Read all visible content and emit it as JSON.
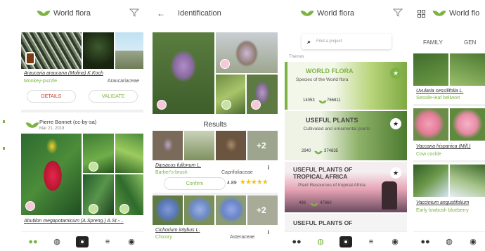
{
  "s1": {
    "title": "World flora",
    "obs1_species": "Araucaria araucana (Molina) K.Koch",
    "obs1_common": "Monkey-puzzle",
    "obs1_family": "Araucariaceae",
    "details_label": "DETAILS",
    "validate_label": "VALIDATE",
    "obs2_author": "Pierre Bonnet (cc-by-sa)",
    "obs2_date": "Mar 21, 2019",
    "obs3_species": "Abutilon megapotamicum (A.Spreng.) A.St.-..."
  },
  "s2": {
    "title": "Identification",
    "results_label": "Results",
    "r1_species": "Dipsacus fullonum L.",
    "r1_common": "Barber's-brush",
    "r1_family": "Caprifoliaceae",
    "r1_score": "4.89",
    "confirm_label": "Confirm",
    "plus_more": "+2",
    "r2_species": "Cichorium intybus L.",
    "r2_common": "Chicory",
    "r2_family": "Asteraceae",
    "r2_plus": "+2",
    "info": "i"
  },
  "s3": {
    "title": "World flora",
    "search_placeholder": "Find a project",
    "themes_label": "Themes",
    "t1_title": "WORLD FLORA",
    "t1_sub": "Species of the World flora",
    "t1_count_a": "14053",
    "t1_count_b": "766811",
    "t2_title": "USEFUL PLANTS",
    "t2_sub": "Cultivated and ornamental plants",
    "t2_count_a": "2940",
    "t2_count_b": "374835",
    "t3_title": "USEFUL PLANTS OF TROPICAL AFRICA",
    "t3_sub": "Plant Resources of tropical Africa",
    "t3_count_a": "498",
    "t3_count_b": "47860",
    "t4_title": "USEFUL PLANTS OF"
  },
  "s4": {
    "title": "World flo",
    "tab_family": "FAMILY",
    "tab_genus": "GEN",
    "sp1": "Uvularia sessilifolia L.",
    "sp1_common": "Sessile-leaf bellwort",
    "sp2": "Vaccaria hispanica (Mill.)",
    "sp2_common": "Cow cockle",
    "sp3": "Vaccinium angustifolium",
    "sp3_common": "Early lowbush blueberry"
  },
  "colors": {
    "accent": "#7cb342",
    "validate": "#7cb342",
    "details": "#c0392b",
    "star": "#f1c40f"
  }
}
